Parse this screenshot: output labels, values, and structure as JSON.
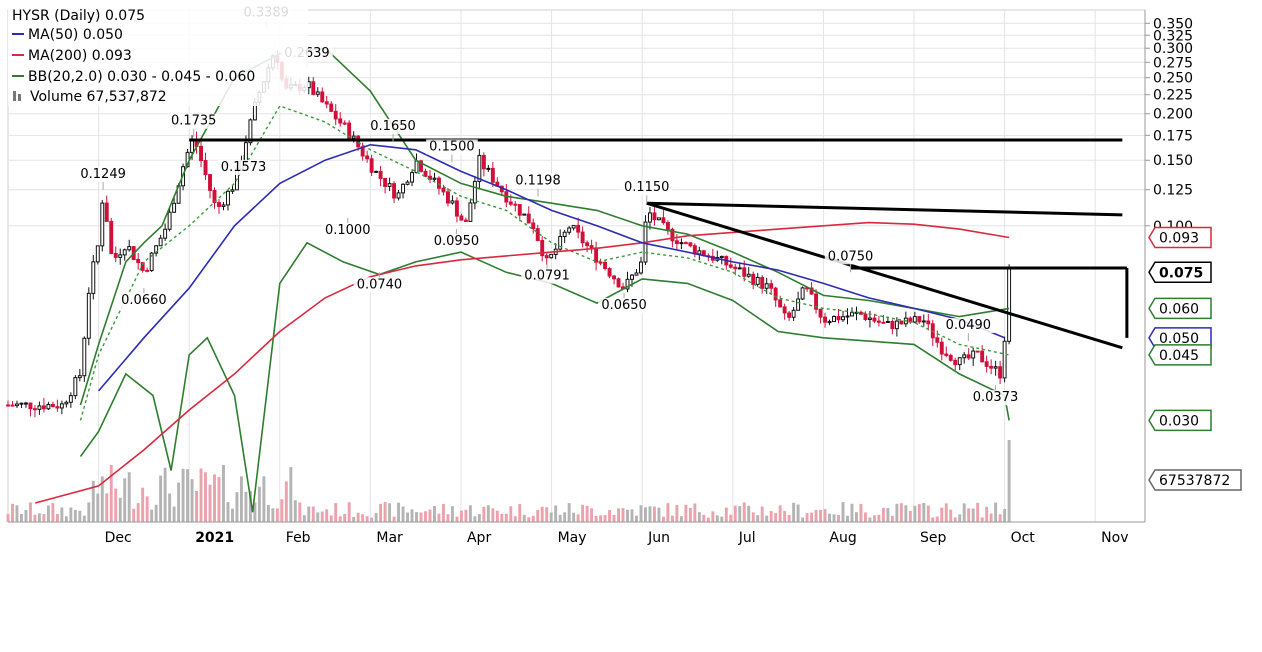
{
  "legend": {
    "title": "HYSR (Daily) 0.075",
    "ma50": "MA(50) 0.050",
    "ma200": "MA(200) 0.093",
    "bb": "BB(20,2.0) 0.030 - 0.045 - 0.060",
    "volume": "Volume 67,537,872"
  },
  "colors": {
    "up": "#111111",
    "down": "#d0103a",
    "ma50": "#2b2bb5",
    "ma200": "#d9293f",
    "bb_band": "#2f7d2f",
    "bb_mid": "#3a9a3a",
    "vol_up": "#b4b4b4",
    "vol_down": "#eba2ac",
    "trendline": "#000000",
    "grid": "#e4e4e4"
  },
  "chart_data": {
    "type": "candlestick",
    "y_scale": "log",
    "ylim": [
      0.016,
      0.38
    ],
    "y_ticks": [
      "0.350",
      "0.325",
      "0.300",
      "0.275",
      "0.250",
      "0.225",
      "0.200",
      "0.175",
      "0.150",
      "0.125",
      "0.100"
    ],
    "x_labels": [
      {
        "label": "Dec",
        "month": 1
      },
      {
        "label": "2021",
        "month": 2,
        "bold": true
      },
      {
        "label": "Feb",
        "month": 3
      },
      {
        "label": "Mar",
        "month": 4
      },
      {
        "label": "Apr",
        "month": 5
      },
      {
        "label": "May",
        "month": 6
      },
      {
        "label": "Jun",
        "month": 7
      },
      {
        "label": "Jul",
        "month": 8
      },
      {
        "label": "Aug",
        "month": 9
      },
      {
        "label": "Sep",
        "month": 10
      },
      {
        "label": "Oct",
        "month": 11
      },
      {
        "label": "Nov",
        "month": 12
      }
    ],
    "price_path": [
      [
        0,
        0.033
      ],
      [
        0.6,
        0.033
      ],
      [
        0.8,
        0.04
      ],
      [
        0.9,
        0.07
      ],
      [
        1.0,
        0.09
      ],
      [
        1.05,
        0.1249
      ],
      [
        1.15,
        0.08
      ],
      [
        1.3,
        0.09
      ],
      [
        1.5,
        0.075
      ],
      [
        1.75,
        0.1
      ],
      [
        1.95,
        0.15
      ],
      [
        2.05,
        0.1735
      ],
      [
        2.3,
        0.11
      ],
      [
        2.5,
        0.13
      ],
      [
        2.75,
        0.22
      ],
      [
        2.95,
        0.3
      ],
      [
        3.05,
        0.23
      ],
      [
        3.3,
        0.24
      ],
      [
        3.5,
        0.21
      ],
      [
        3.75,
        0.18
      ],
      [
        4.05,
        0.14
      ],
      [
        4.3,
        0.12
      ],
      [
        4.5,
        0.15
      ],
      [
        4.9,
        0.115
      ],
      [
        5.05,
        0.1
      ],
      [
        5.2,
        0.15
      ],
      [
        5.5,
        0.12
      ],
      [
        5.8,
        0.1
      ],
      [
        5.95,
        0.0791
      ],
      [
        6.2,
        0.1
      ],
      [
        6.5,
        0.082
      ],
      [
        6.8,
        0.068
      ],
      [
        7.0,
        0.08
      ],
      [
        7.05,
        0.11
      ],
      [
        7.3,
        0.095
      ],
      [
        7.5,
        0.088
      ],
      [
        7.8,
        0.082
      ],
      [
        8.1,
        0.075
      ],
      [
        8.4,
        0.068
      ],
      [
        8.6,
        0.055
      ],
      [
        8.8,
        0.068
      ],
      [
        9.0,
        0.056
      ],
      [
        9.4,
        0.058
      ],
      [
        9.7,
        0.054
      ],
      [
        10.1,
        0.056
      ],
      [
        10.3,
        0.047
      ],
      [
        10.5,
        0.043
      ],
      [
        10.7,
        0.045
      ],
      [
        10.95,
        0.04
      ],
      [
        11.0,
        0.05
      ],
      [
        11.05,
        0.075
      ]
    ],
    "ma50": [
      [
        1.0,
        0.036
      ],
      [
        1.5,
        0.05
      ],
      [
        2.0,
        0.068
      ],
      [
        2.5,
        0.1
      ],
      [
        3.0,
        0.13
      ],
      [
        3.5,
        0.15
      ],
      [
        4.0,
        0.165
      ],
      [
        4.5,
        0.16
      ],
      [
        5.0,
        0.14
      ],
      [
        5.5,
        0.125
      ],
      [
        6.0,
        0.11
      ],
      [
        6.5,
        0.1
      ],
      [
        7.0,
        0.09
      ],
      [
        7.5,
        0.085
      ],
      [
        8.0,
        0.08
      ],
      [
        8.5,
        0.076
      ],
      [
        9.0,
        0.07
      ],
      [
        9.5,
        0.064
      ],
      [
        10.0,
        0.06
      ],
      [
        10.5,
        0.056
      ],
      [
        11.0,
        0.05
      ]
    ],
    "ma200": [
      [
        0.3,
        0.018
      ],
      [
        1.0,
        0.02
      ],
      [
        1.5,
        0.025
      ],
      [
        2.0,
        0.032
      ],
      [
        2.5,
        0.04
      ],
      [
        3.0,
        0.052
      ],
      [
        3.5,
        0.064
      ],
      [
        4.0,
        0.073
      ],
      [
        4.5,
        0.078
      ],
      [
        5.0,
        0.081
      ],
      [
        5.5,
        0.083
      ],
      [
        6.0,
        0.085
      ],
      [
        6.5,
        0.087
      ],
      [
        7.0,
        0.09
      ],
      [
        7.5,
        0.094
      ],
      [
        8.0,
        0.096
      ],
      [
        8.5,
        0.098
      ],
      [
        9.0,
        0.1
      ],
      [
        9.5,
        0.102
      ],
      [
        10.0,
        0.101
      ],
      [
        10.5,
        0.098
      ],
      [
        11.05,
        0.093
      ]
    ],
    "bb_mid": [
      [
        0.8,
        0.03
      ],
      [
        1.0,
        0.045
      ],
      [
        1.5,
        0.08
      ],
      [
        2.0,
        0.1
      ],
      [
        2.5,
        0.13
      ],
      [
        3.0,
        0.21
      ],
      [
        3.5,
        0.19
      ],
      [
        4.0,
        0.16
      ],
      [
        4.5,
        0.14
      ],
      [
        5.0,
        0.12
      ],
      [
        5.5,
        0.11
      ],
      [
        6.0,
        0.09
      ],
      [
        6.5,
        0.08
      ],
      [
        7.0,
        0.085
      ],
      [
        7.5,
        0.082
      ],
      [
        8.0,
        0.075
      ],
      [
        8.5,
        0.064
      ],
      [
        9.0,
        0.06
      ],
      [
        9.5,
        0.058
      ],
      [
        10.0,
        0.055
      ],
      [
        10.5,
        0.048
      ],
      [
        11.05,
        0.045
      ]
    ],
    "bb_upper": [
      [
        0.8,
        0.033
      ],
      [
        1.0,
        0.048
      ],
      [
        1.3,
        0.08
      ],
      [
        1.5,
        0.09
      ],
      [
        1.7,
        0.1
      ],
      [
        2.0,
        0.15
      ],
      [
        2.5,
        0.25
      ],
      [
        3.0,
        0.29
      ],
      [
        3.5,
        0.3
      ],
      [
        4.0,
        0.23
      ],
      [
        4.5,
        0.15
      ],
      [
        5.0,
        0.13
      ],
      [
        5.5,
        0.12
      ],
      [
        6.0,
        0.115
      ],
      [
        6.5,
        0.11
      ],
      [
        7.0,
        0.1
      ],
      [
        7.5,
        0.095
      ],
      [
        8.0,
        0.085
      ],
      [
        8.5,
        0.075
      ],
      [
        9.0,
        0.065
      ],
      [
        9.5,
        0.063
      ],
      [
        10.0,
        0.06
      ],
      [
        10.5,
        0.057
      ],
      [
        11.05,
        0.06
      ]
    ],
    "bb_lower": [
      [
        0.8,
        0.024
      ],
      [
        1.0,
        0.028
      ],
      [
        1.3,
        0.04
      ],
      [
        1.6,
        0.035
      ],
      [
        1.8,
        0.022
      ],
      [
        2.0,
        0.045
      ],
      [
        2.2,
        0.05
      ],
      [
        2.5,
        0.035
      ],
      [
        2.7,
        0.017
      ],
      [
        3.0,
        0.07
      ],
      [
        3.3,
        0.09
      ],
      [
        3.7,
        0.08
      ],
      [
        4.1,
        0.074
      ],
      [
        4.5,
        0.08
      ],
      [
        5.0,
        0.085
      ],
      [
        5.5,
        0.075
      ],
      [
        6.0,
        0.07
      ],
      [
        6.5,
        0.062
      ],
      [
        7.0,
        0.072
      ],
      [
        7.5,
        0.07
      ],
      [
        8.0,
        0.063
      ],
      [
        8.5,
        0.052
      ],
      [
        9.0,
        0.05
      ],
      [
        9.5,
        0.049
      ],
      [
        10.0,
        0.048
      ],
      [
        10.5,
        0.04
      ],
      [
        11.0,
        0.035
      ],
      [
        11.05,
        0.03
      ]
    ],
    "price_labels": [
      {
        "text": "0.1249",
        "month": 1.05,
        "value": 0.1249,
        "pos": "above"
      },
      {
        "text": "0.0660",
        "month": 1.5,
        "value": 0.068,
        "pos": "below"
      },
      {
        "text": "0.1735",
        "month": 2.05,
        "value": 0.1735,
        "pos": "above"
      },
      {
        "text": "0.3389",
        "month": 2.85,
        "value": 0.3389,
        "pos": "above"
      },
      {
        "text": "0.1573",
        "month": 2.6,
        "value": 0.155,
        "pos": "below"
      },
      {
        "text": "0.2639",
        "month": 3.3,
        "value": 0.2639,
        "pos": "above"
      },
      {
        "text": "0.1000",
        "month": 3.75,
        "value": 0.105,
        "pos": "below"
      },
      {
        "text": "0.1650",
        "month": 4.25,
        "value": 0.168,
        "pos": "above"
      },
      {
        "text": "0.0740",
        "month": 4.1,
        "value": 0.075,
        "pos": "below"
      },
      {
        "text": "0.1500",
        "month": 4.9,
        "value": 0.148,
        "pos": "above"
      },
      {
        "text": "0.0950",
        "month": 4.95,
        "value": 0.098,
        "pos": "below"
      },
      {
        "text": "0.1198",
        "month": 5.85,
        "value": 0.1198,
        "pos": "above"
      },
      {
        "text": "0.0791",
        "month": 5.95,
        "value": 0.0791,
        "pos": "below"
      },
      {
        "text": "0.0650",
        "month": 6.8,
        "value": 0.066,
        "pos": "below"
      },
      {
        "text": "0.1150",
        "month": 7.05,
        "value": 0.115,
        "pos": "above"
      },
      {
        "text": "0.0750",
        "month": 9.3,
        "value": 0.075,
        "pos": "above"
      },
      {
        "text": "0.0490",
        "month": 10.6,
        "value": 0.049,
        "pos": "above"
      },
      {
        "text": "0.0373",
        "month": 10.9,
        "value": 0.0373,
        "pos": "below"
      }
    ],
    "trendlines": [
      {
        "x1": 2.0,
        "v1": 0.17,
        "x2": 12.3,
        "v2": 0.17
      },
      {
        "x1": 7.05,
        "v1": 0.115,
        "x2": 12.3,
        "v2": 0.107
      },
      {
        "x1": 7.05,
        "v1": 0.115,
        "x2": 12.3,
        "v2": 0.047
      },
      {
        "x1": 9.3,
        "v1": 0.077,
        "x2": 12.35,
        "v2": 0.077
      },
      {
        "x1": 12.35,
        "v1": 0.077,
        "x2": 12.35,
        "v2": 0.05
      }
    ],
    "badges": [
      {
        "text": "0.093",
        "value": 0.093,
        "color": "#d9293f",
        "bold": false
      },
      {
        "text": "0.075",
        "value": 0.075,
        "color": "#000000",
        "bold": true
      },
      {
        "text": "0.060",
        "value": 0.06,
        "color": "#2f7d2f",
        "bold": false
      },
      {
        "text": "0.050",
        "value": 0.05,
        "color": "#2b2bb5",
        "bold": false
      },
      {
        "text": "0.045",
        "value": 0.045,
        "color": "#2f7d2f",
        "bold": false
      },
      {
        "text": "0.030",
        "value": 0.03,
        "color": "#2f7d2f",
        "bold": false
      }
    ],
    "volume": {
      "last": "67537872",
      "last_value": 67537872,
      "max": 95000000
    }
  }
}
